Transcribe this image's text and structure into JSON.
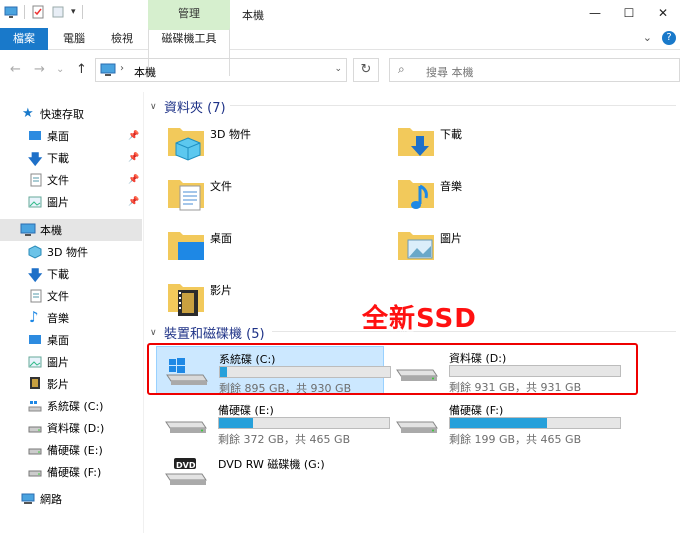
{
  "window": {
    "title": "本機",
    "manage_label": "管理",
    "minimize": "—",
    "maximize": "☐",
    "close": "✕"
  },
  "ribbon": {
    "tabs": [
      "檔案",
      "電腦",
      "檢視",
      "磁碟機工具"
    ],
    "expand": "⌄",
    "help": "?"
  },
  "address": {
    "back": "←",
    "forward": "→",
    "up": "↑",
    "sep": "›",
    "path": "本機",
    "dropdown": "⌄",
    "refresh": "↻",
    "search_placeholder": "搜尋 本機"
  },
  "nav": {
    "quick_access": "快速存取",
    "quick_items": [
      "桌面",
      "下載",
      "文件",
      "圖片"
    ],
    "pin": "📌",
    "this_pc": "本機",
    "pc_items": [
      "3D 物件",
      "下載",
      "文件",
      "音樂",
      "桌面",
      "圖片",
      "影片",
      "系統碟 (C:)",
      "資料碟 (D:)",
      "備硬碟 (E:)",
      "備硬碟 (F:)"
    ],
    "network": "網路"
  },
  "content": {
    "folders_header": "資料夾 (7)",
    "folders": [
      "3D 物件",
      "下載",
      "文件",
      "音樂",
      "桌面",
      "圖片",
      "影片"
    ],
    "drives_header": "裝置和磁碟機 (5)",
    "drives": [
      {
        "name": "系統碟 (C:)",
        "free": "剩餘 895 GB，共 930 GB",
        "used_fraction": 0.04
      },
      {
        "name": "資料碟 (D:)",
        "free": "剩餘 931 GB，共 931 GB",
        "used_fraction": 0.0
      },
      {
        "name": "備硬碟 (E:)",
        "free": "剩餘 372 GB，共 465 GB",
        "used_fraction": 0.2
      },
      {
        "name": "備硬碟 (F:)",
        "free": "剩餘 199 GB，共 465 GB",
        "used_fraction": 0.57
      },
      {
        "name": "DVD RW 磁碟機 (G:)"
      }
    ],
    "dvd_badge": "DVD"
  },
  "annotation": {
    "label": "全新SSD",
    "color": "#ff1111"
  },
  "colors": {
    "accent": "#1979ca",
    "manage_tab": "#d6efce",
    "group_title": "#1e3287",
    "bar_fill": "#26a0da",
    "selection": "#cce8ff"
  }
}
